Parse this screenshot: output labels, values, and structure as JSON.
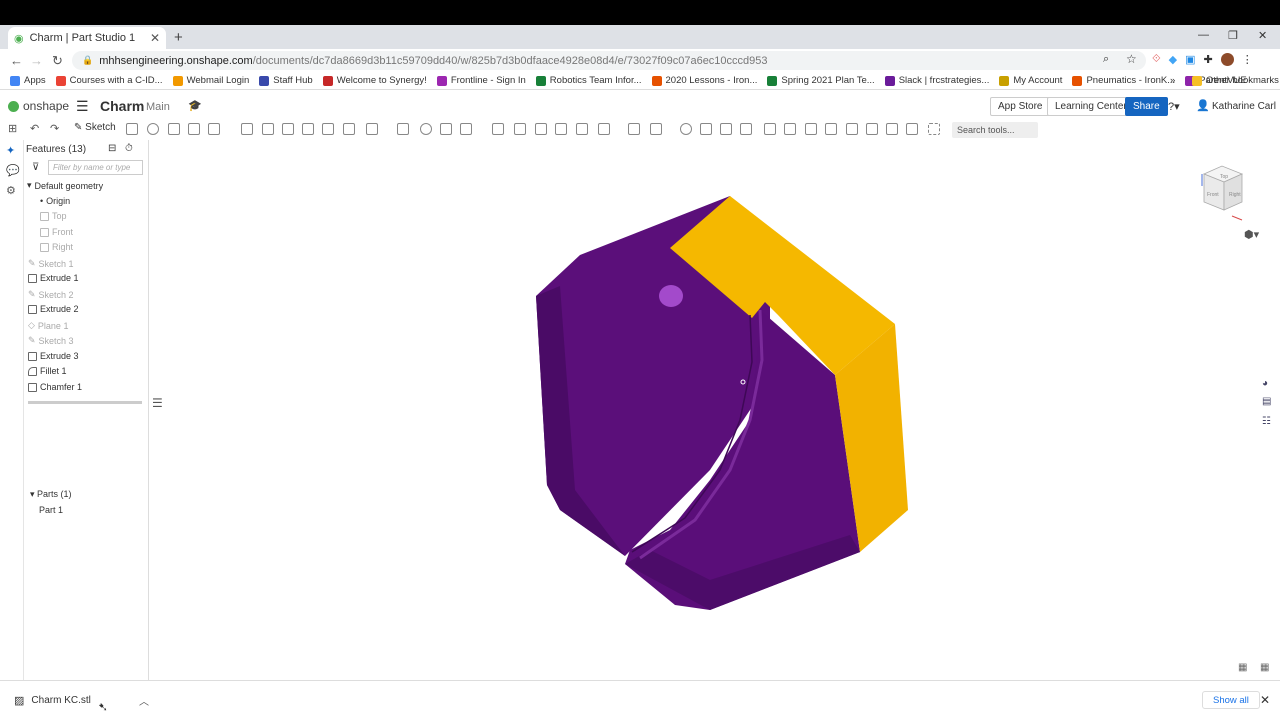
{
  "browser": {
    "tab_title": "Charm | Part Studio 1",
    "url_host": "mhhsengineering.onshape.com",
    "url_path": "/documents/dc7da8669d3b11c59709dd40/w/825b7d3b0dfaace4928e08d4/e/73027f09c07a6ec10cccd953",
    "bookmarks": [
      "Apps",
      "Courses with a C-ID...",
      "Webmail Login",
      "Staff Hub",
      "Welcome to Synergy!",
      "Frontline - Sign In",
      "Robotics Team Infor...",
      "2020 Lessons - Iron...",
      "Spring 2021 Plan Te...",
      "Slack | frcstrategies...",
      "My Account",
      "Pneumatics - IronK...",
      "ParentVUE"
    ],
    "other_bookmarks": "Other bookmarks",
    "bookmark_colors": [
      "#4285f4",
      "#ea4335",
      "#f29900",
      "#3949ab",
      "#c62828",
      "#9c27b0",
      "#188038",
      "#e65100",
      "#188038",
      "#6a1b9a",
      "#c8a000",
      "#e65100",
      "#8e24aa"
    ]
  },
  "onshape": {
    "logo_text": "onshape",
    "doc_title": "Charm",
    "branch": "Main",
    "app_store": "App Store",
    "learning_center": "Learning Center",
    "share": "Share",
    "user": "Katharine Carl",
    "sketch_label": "Sketch",
    "search_tools": "Search tools..."
  },
  "features": {
    "header": "Features (13)",
    "filter_placeholder": "Filter by name or type",
    "default_geometry": "Default geometry",
    "items": [
      {
        "label": "Origin",
        "dim": false
      },
      {
        "label": "Top",
        "dim": true
      },
      {
        "label": "Front",
        "dim": true
      },
      {
        "label": "Right",
        "dim": true
      },
      {
        "label": "Sketch 1",
        "dim": true
      },
      {
        "label": "Extrude 1",
        "dim": false
      },
      {
        "label": "Sketch 2",
        "dim": true
      },
      {
        "label": "Extrude 2",
        "dim": false
      },
      {
        "label": "Plane 1",
        "dim": true
      },
      {
        "label": "Sketch 3",
        "dim": true
      },
      {
        "label": "Extrude 3",
        "dim": false
      },
      {
        "label": "Fillet 1",
        "dim": false
      },
      {
        "label": "Chamfer 1",
        "dim": false
      }
    ],
    "parts_header": "Parts (1)",
    "part_name": "Part 1"
  },
  "viewcube": {
    "top": "Top",
    "front": "Front",
    "right": "Right"
  },
  "download": {
    "file": "Charm KC.stl",
    "show_all": "Show all"
  },
  "colors": {
    "purple": "#5b0f7a",
    "yellow": "#f5b800",
    "accent": "#1565c0"
  }
}
